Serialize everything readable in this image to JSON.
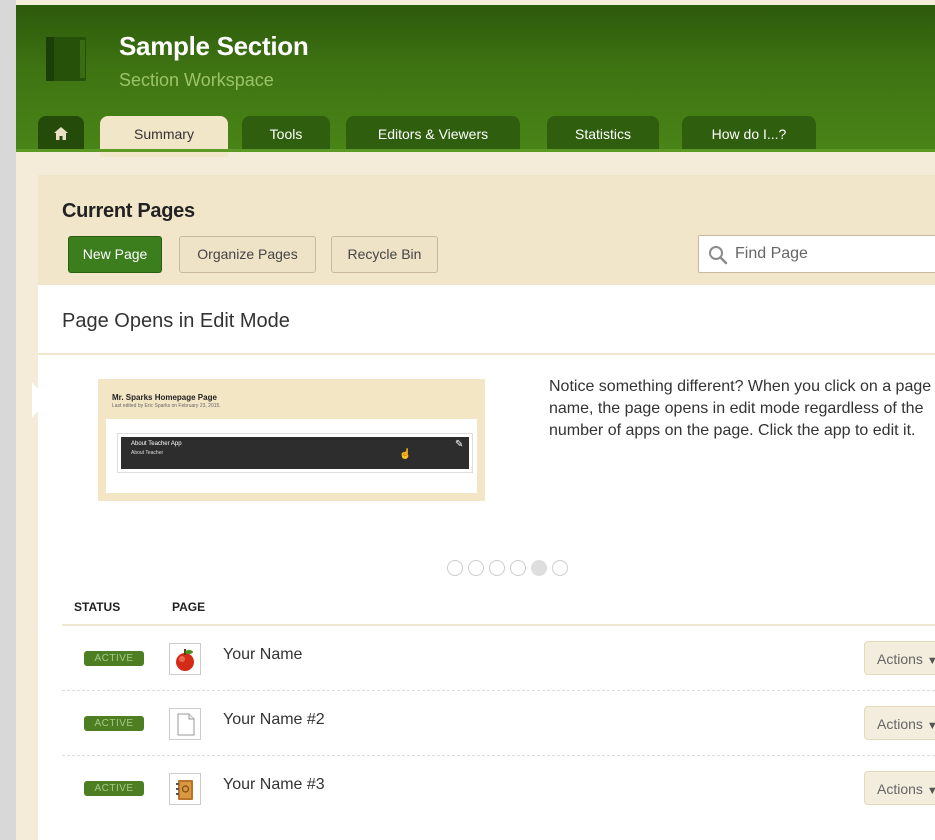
{
  "header": {
    "title": "Sample Section",
    "subtitle": "Section Workspace"
  },
  "tabs": [
    {
      "label": "Summary"
    },
    {
      "label": "Tools"
    },
    {
      "label": "Editors & Viewers"
    },
    {
      "label": "Statistics"
    },
    {
      "label": "How do I...?"
    }
  ],
  "current_pages": {
    "heading": "Current Pages",
    "buttons": {
      "new": "New Page",
      "organize": "Organize Pages",
      "recycle": "Recycle Bin"
    },
    "search": {
      "placeholder": "Find Page"
    }
  },
  "notice": {
    "title": "Page Opens in Edit Mode",
    "body": "Notice something different? When you click on a page name, the page opens in edit mode regardless of the number of apps on the page. Click the app to edit it.",
    "preview": {
      "page_title": "Mr. Sparks Homepage Page",
      "page_sub": "Last edited by Eric Sparks on February 23, 2015.",
      "app_title": "About Teacher App",
      "app_sub": "About Teacher"
    },
    "carousel": {
      "count": 6,
      "active_index": 4
    }
  },
  "table": {
    "columns": {
      "status": "STATUS",
      "page": "PAGE"
    },
    "rows": [
      {
        "status": "ACTIVE",
        "name": "Your Name",
        "icon": "apple-icon",
        "actions": "Actions"
      },
      {
        "status": "ACTIVE",
        "name": "Your Name #2",
        "icon": "blank-page-icon",
        "actions": "Actions"
      },
      {
        "status": "ACTIVE",
        "name": "Your Name #3",
        "icon": "address-book-icon",
        "actions": "Actions"
      }
    ]
  },
  "colors": {
    "header_green": "#3f7412",
    "accent_green": "#3c7e1e",
    "panel_cream": "#f1e6ca"
  }
}
